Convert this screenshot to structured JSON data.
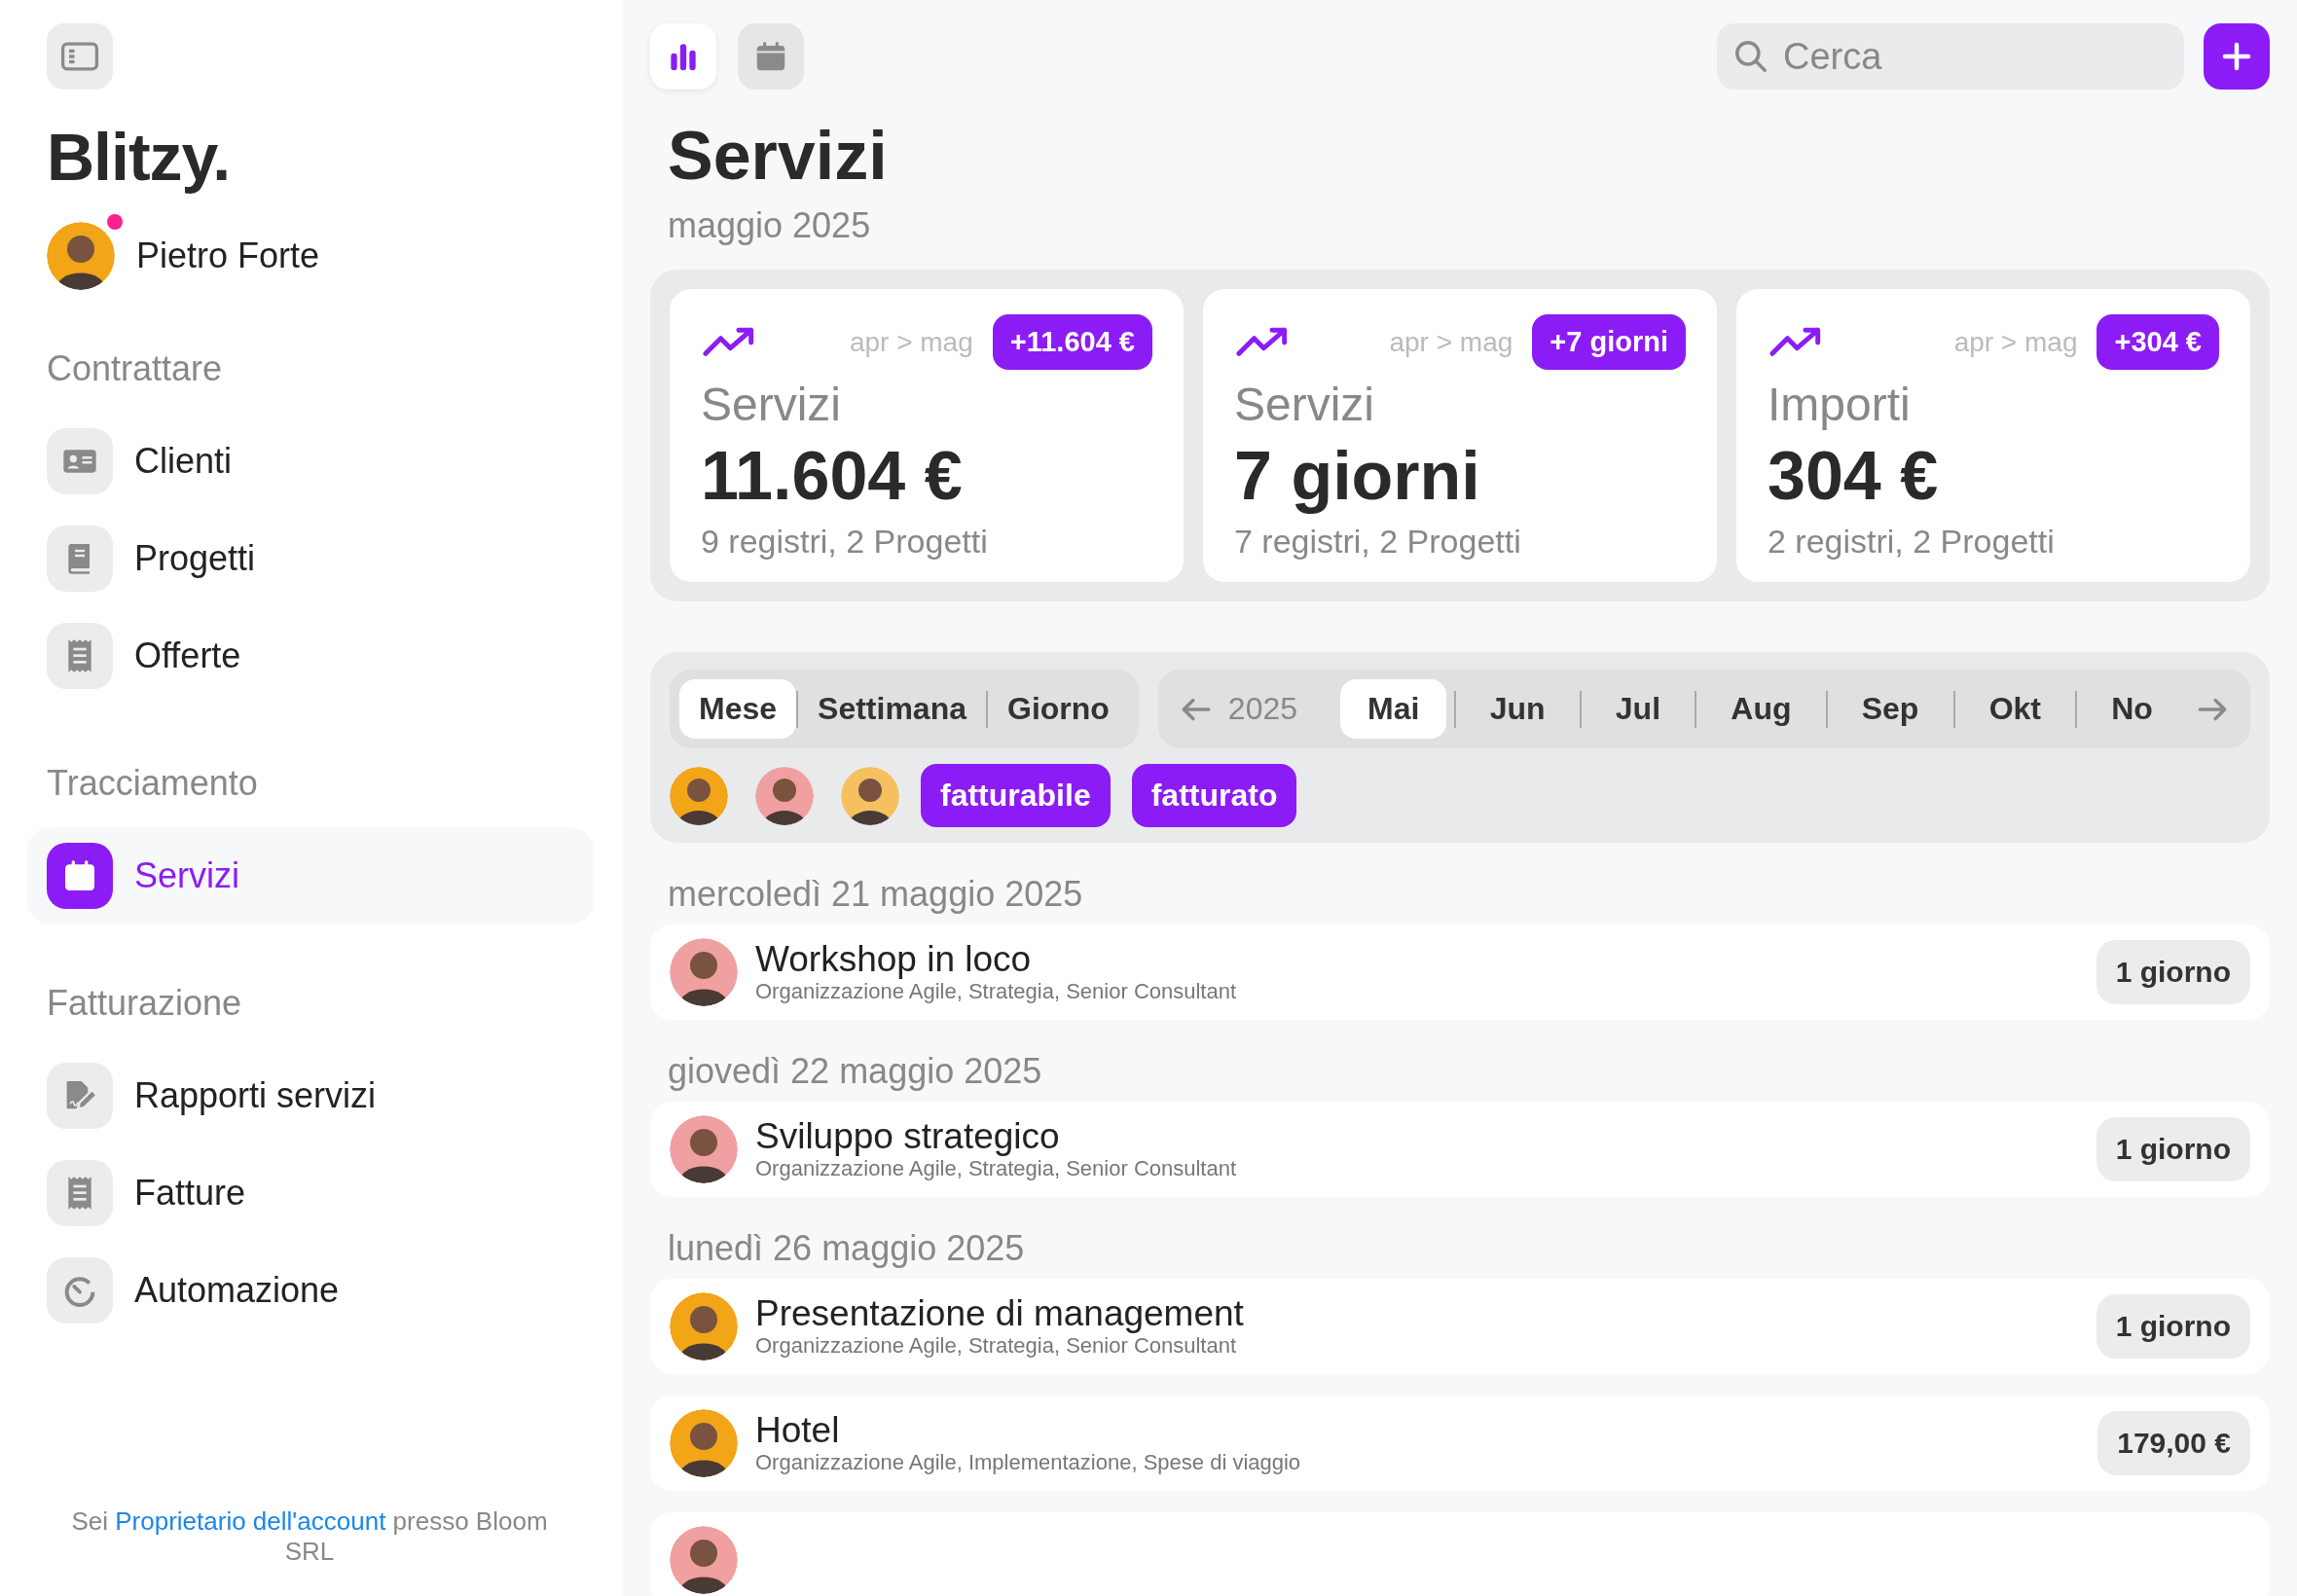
{
  "sidebar": {
    "brand": "Blitzy.",
    "user": {
      "name": "Pietro Forte",
      "color": "#f2a516",
      "notification": true
    },
    "sections": [
      {
        "title": "Contrattare",
        "items": [
          {
            "label": "Clienti",
            "kind": "contacts",
            "selected": false
          },
          {
            "label": "Progetti",
            "kind": "book",
            "selected": false
          },
          {
            "label": "Offerte",
            "kind": "receipt",
            "selected": false
          }
        ]
      },
      {
        "title": "Tracciamento",
        "items": [
          {
            "label": "Servizi",
            "kind": "calendar",
            "selected": true
          }
        ]
      },
      {
        "title": "Fatturazione",
        "items": [
          {
            "label": "Rapporti servizi",
            "kind": "signature",
            "selected": false
          },
          {
            "label": "Fatture",
            "kind": "receipt",
            "selected": false
          },
          {
            "label": "Automazione",
            "kind": "timer",
            "selected": false
          }
        ]
      }
    ],
    "footer": {
      "prefix": "Sei",
      "link": "Proprietario dell'account",
      "suffix": "presso Bloom SRL"
    }
  },
  "view_buttons": [
    {
      "kind": "chart",
      "selected": true
    },
    {
      "kind": "calendar",
      "selected": false
    }
  ],
  "search": {
    "placeholder": "Cerca"
  },
  "page": {
    "title": "Servizi",
    "subtitle": "maggio 2025"
  },
  "stats": [
    {
      "period": "apr > mag",
      "delta": "+11.604 €",
      "label": "Servizi",
      "value": "11.604 €",
      "detail": "9 registri, 2 Progetti"
    },
    {
      "period": "apr > mag",
      "delta": "+7 giorni",
      "label": "Servizi",
      "value": "7 giorni",
      "detail": "7 registri, 2 Progetti"
    },
    {
      "period": "apr > mag",
      "delta": "+304 €",
      "label": "Importi",
      "value": "304 €",
      "detail": "2 registri, 2 Progetti"
    }
  ],
  "filters": {
    "ranges": [
      {
        "label": "Mese",
        "selected": true
      },
      {
        "label": "Settimana",
        "selected": false
      },
      {
        "label": "Giorno",
        "selected": false
      }
    ],
    "year": "2025",
    "months": [
      {
        "label": "Mai",
        "selected": true
      },
      {
        "label": "Jun",
        "selected": false
      },
      {
        "label": "Jul",
        "selected": false
      },
      {
        "label": "Aug",
        "selected": false
      },
      {
        "label": "Sep",
        "selected": false
      },
      {
        "label": "Okt",
        "selected": false
      },
      {
        "label": "No",
        "selected": false
      }
    ],
    "people": [
      {
        "color": "#f2a516"
      },
      {
        "color": "#f0a0a0"
      },
      {
        "color": "#f5c060"
      }
    ],
    "chips": [
      {
        "label": "fatturabile",
        "selected": true
      },
      {
        "label": "fatturato",
        "selected": true
      }
    ]
  },
  "groups": [
    {
      "date": "mercoledì 21 maggio 2025",
      "entries": [
        {
          "title": "Workshop in loco",
          "subtitle": "Organizzazione Agile, Strategia, Senior Consultant",
          "amount": "1 giorno",
          "color": "#f0a0a0"
        }
      ]
    },
    {
      "date": "giovedì 22 maggio 2025",
      "entries": [
        {
          "title": "Sviluppo strategico",
          "subtitle": "Organizzazione Agile, Strategia, Senior Consultant",
          "amount": "1 giorno",
          "color": "#f0a0a0"
        }
      ]
    },
    {
      "date": "lunedì 26 maggio 2025",
      "entries": [
        {
          "title": "Presentazione di management",
          "subtitle": "Organizzazione Agile, Strategia, Senior Consultant",
          "amount": "1 giorno",
          "color": "#f2a516"
        },
        {
          "title": "Hotel",
          "subtitle": "Organizzazione Agile, Implementazione, Spese di viaggio",
          "amount": "179,00 €",
          "color": "#f2a516"
        },
        {
          "color": "#f0a0a0"
        }
      ]
    }
  ]
}
